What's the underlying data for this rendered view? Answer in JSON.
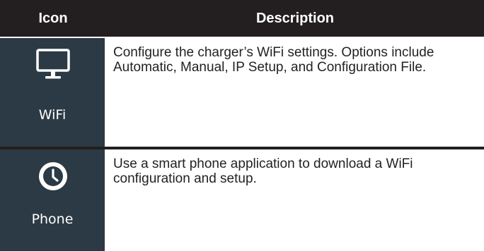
{
  "header": {
    "icon_col": "Icon",
    "description_col": "Description"
  },
  "rows": [
    {
      "icon": "monitor-icon",
      "label": "WiFi",
      "description": "Configure the charger’s WiFi settings. Options include Automatic, Manual, IP Setup, and Configuration File."
    },
    {
      "icon": "clock-icon",
      "label": "Phone",
      "description": "Use a smart phone application to download a WiFi configuration and setup."
    }
  ],
  "colors": {
    "header_bg": "#231f20",
    "icon_cell_bg": "#2b3a44",
    "text": "#231f20",
    "icon_text": "#ffffff"
  }
}
